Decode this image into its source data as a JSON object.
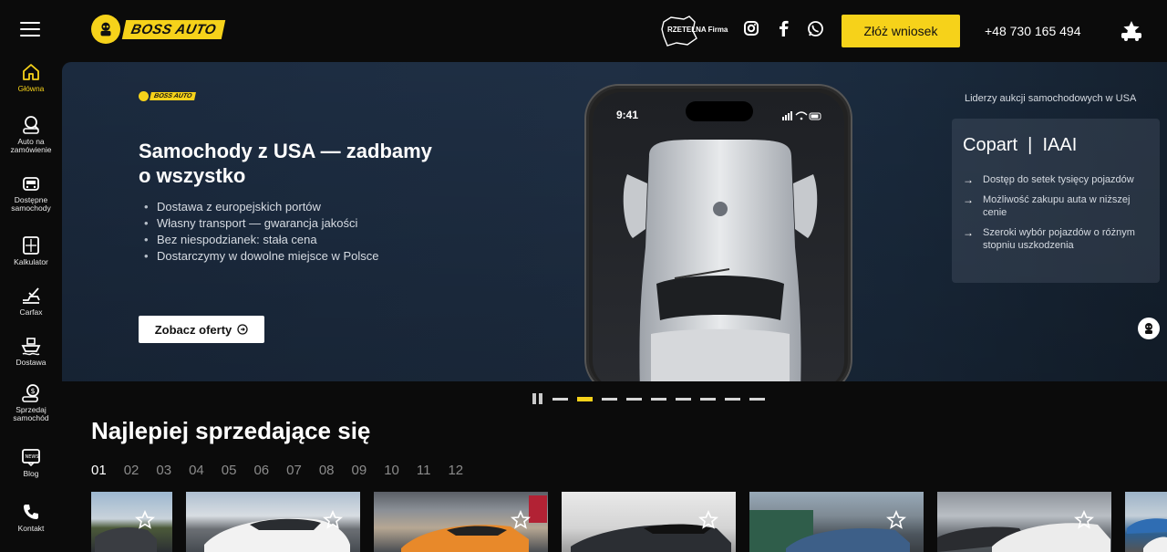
{
  "header": {
    "logo_text": "BOSS AUTO",
    "rzetelna": "RZETELNA Firma",
    "cta_label": "Złóż wniosek",
    "phone": "+48 730 165 494",
    "social": [
      "instagram-icon",
      "facebook-icon",
      "whatsapp-icon"
    ]
  },
  "sidebar": {
    "items": [
      {
        "label": "Główna",
        "icon": "home-icon",
        "active": true
      },
      {
        "label": "Auto na zamówienie",
        "icon": "search-car-icon"
      },
      {
        "label": "Dostępne samochody",
        "icon": "car-front-icon"
      },
      {
        "label": "Kalkulator",
        "icon": "calculator-icon"
      },
      {
        "label": "Carfax",
        "icon": "carfax-icon"
      },
      {
        "label": "Dostawa",
        "icon": "ship-icon"
      },
      {
        "label": "Sprzedaj samochód",
        "icon": "sell-car-icon"
      },
      {
        "label": "Blog",
        "icon": "news-icon"
      },
      {
        "label": "Kontakt",
        "icon": "phone-icon"
      }
    ]
  },
  "hero": {
    "logo_text": "BOSS AUTO",
    "title": "Samochody z USA — zadbamy o wszystko",
    "bullets": [
      "Dostawa z europejskich portów",
      "Własny transport — gwarancja jakości",
      "Bez niespodzianek: stała cena",
      "Dostarczymy w dowolne miejsce w Polsce"
    ],
    "button_label": "Zobacz oferty",
    "phone_time": "9:41",
    "tagline": "Liderzy aukcji samochodowych w USA",
    "card_brands": "Copart  |  IAAI",
    "card_points": [
      "Dostęp do setek tysięcy pojazdów",
      "Możliwość zakupu auta w niższej cenie",
      "Szeroki wybór pojazdów o różnym stopniu uszkodzenia"
    ],
    "slides_count": 9,
    "active_slide": 2
  },
  "best_sellers": {
    "title": "Najlepiej sprzedające się",
    "pages": [
      "01",
      "02",
      "03",
      "04",
      "05",
      "06",
      "07",
      "08",
      "09",
      "10",
      "11",
      "12"
    ],
    "active_page": "01"
  },
  "colors": {
    "accent": "#f6d21a",
    "background": "#0b0b0b",
    "hero_bg": "#1d2d42"
  }
}
